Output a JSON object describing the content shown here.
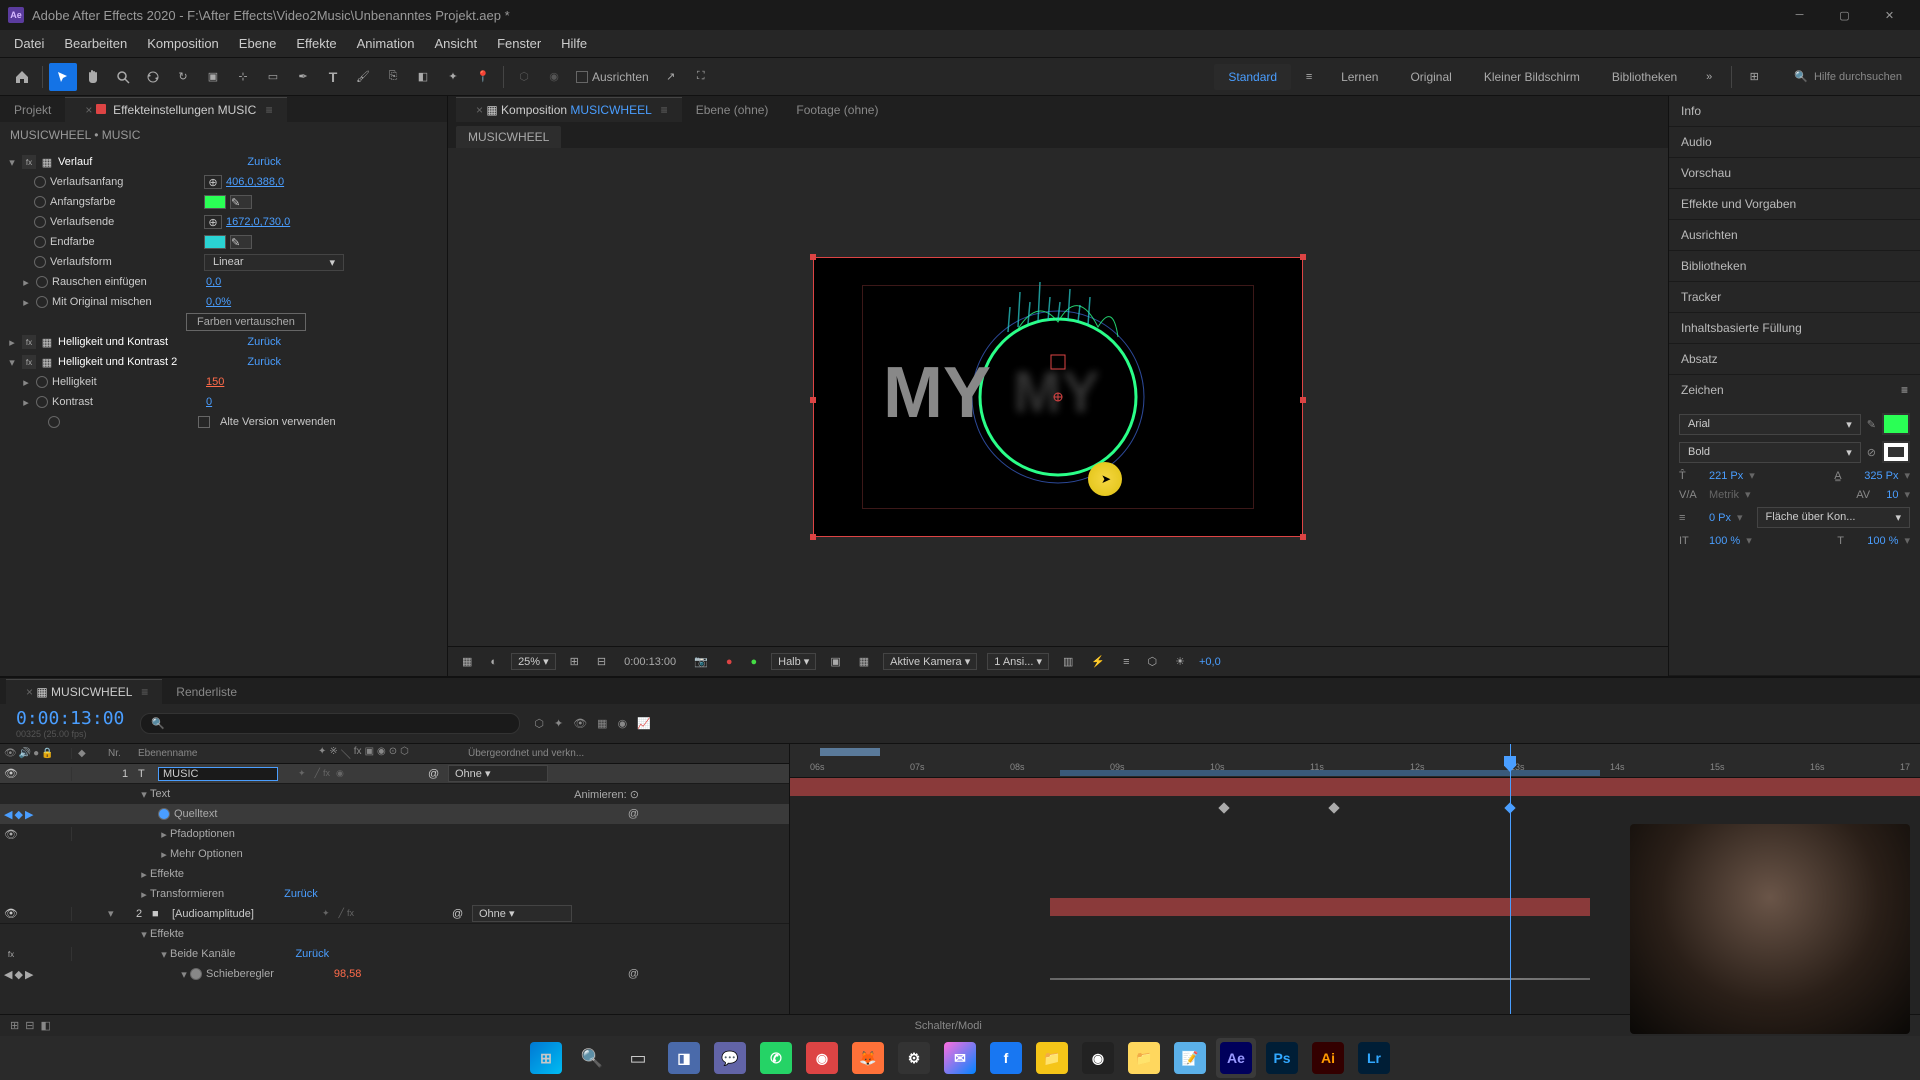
{
  "titlebar": {
    "app": "Ae",
    "title": "Adobe After Effects 2020 - F:\\After Effects\\Video2Music\\Unbenanntes Projekt.aep *"
  },
  "menu": [
    "Datei",
    "Bearbeiten",
    "Komposition",
    "Ebene",
    "Effekte",
    "Animation",
    "Ansicht",
    "Fenster",
    "Hilfe"
  ],
  "toolbar": {
    "align_label": "Ausrichten",
    "workspaces": [
      "Standard",
      "Lernen",
      "Original",
      "Kleiner Bildschirm",
      "Bibliotheken"
    ],
    "active_workspace": 0,
    "search_placeholder": "Hilfe durchsuchen"
  },
  "left": {
    "tabs": [
      "Projekt",
      "Effekteinstellungen MUSIC"
    ],
    "active_tab": 1,
    "breadcrumb": "MUSICWHEEL • MUSIC",
    "effects": {
      "verlauf": {
        "name": "Verlauf",
        "reset": "Zurück",
        "anfang": {
          "label": "Verlaufsanfang",
          "value": "406,0,388,0"
        },
        "anfangsfarbe": {
          "label": "Anfangsfarbe",
          "color": "#2aff55"
        },
        "ende": {
          "label": "Verlaufsende",
          "value": "1672,0,730,0"
        },
        "endfarbe": {
          "label": "Endfarbe",
          "color": "#2ad4d4"
        },
        "form": {
          "label": "Verlaufsform",
          "value": "Linear"
        },
        "rauschen": {
          "label": "Rauschen einfügen",
          "value": "0,0"
        },
        "mischen": {
          "label": "Mit Original mischen",
          "value": "0,0%"
        },
        "swap": "Farben vertauschen"
      },
      "hk1": {
        "name": "Helligkeit und Kontrast",
        "reset": "Zurück"
      },
      "hk2": {
        "name": "Helligkeit und Kontrast 2",
        "reset": "Zurück",
        "helligkeit": {
          "label": "Helligkeit",
          "value": "150"
        },
        "kontrast": {
          "label": "Kontrast",
          "value": "0"
        },
        "alte": "Alte Version verwenden"
      }
    }
  },
  "center": {
    "tabs": {
      "comp_prefix": "Komposition",
      "comp_name": "MUSICWHEEL",
      "ebene": "Ebene (ohne)",
      "footage": "Footage (ohne)"
    },
    "crumb": "MUSICWHEEL",
    "preview_text": "MY",
    "viewer": {
      "zoom": "25%",
      "timecode": "0:00:13:00",
      "res": "Halb",
      "camera": "Aktive Kamera",
      "views": "1 Ansi...",
      "exposure": "+0,0"
    }
  },
  "right": {
    "sections": [
      "Info",
      "Audio",
      "Vorschau",
      "Effekte und Vorgaben",
      "Ausrichten",
      "Bibliotheken",
      "Tracker",
      "Inhaltsbasierte Füllung",
      "Absatz"
    ],
    "zeichen": {
      "title": "Zeichen",
      "font": "Arial",
      "weight": "Bold",
      "fill": "#2aff55",
      "size": "221 Px",
      "leading": "325 Px",
      "kerning": "Metrik",
      "tracking": "10",
      "stroke_w": "0 Px",
      "stroke_mode": "Fläche über Kon...",
      "vscale": "100 %",
      "hscale": "100 %"
    }
  },
  "timeline": {
    "tabs": [
      "MUSICWHEEL",
      "Renderliste"
    ],
    "timecode": "0:00:13:00",
    "fps_label": "00325 (25.00 fps)",
    "cols": {
      "nr": "Nr.",
      "name": "Ebenenname",
      "parent": "Übergeordnet und verkn..."
    },
    "layers": {
      "l1": {
        "num": "1",
        "name": "MUSIC",
        "color": "#d44",
        "parent": "Ohne",
        "props": {
          "text": "Text",
          "animieren": "Animieren:",
          "quelltext": "Quelltext",
          "pfad": "Pfadoptionen",
          "mehr": "Mehr Optionen",
          "effekte": "Effekte",
          "transform": "Transformieren",
          "transform_reset": "Zurück"
        }
      },
      "l2": {
        "num": "2",
        "name": "[Audioamplitude]",
        "color": "#eee",
        "parent": "Ohne",
        "props": {
          "effekte": "Effekte",
          "beide": "Beide Kanäle",
          "beide_reset": "Zurück",
          "schieberegler": "Schieberegler",
          "schieberegler_val": "98,58"
        }
      }
    },
    "ruler_ticks": [
      "06s",
      "07s",
      "08s",
      "09s",
      "10s",
      "11s",
      "12s",
      "13s",
      "14s",
      "15s",
      "16s",
      "17"
    ],
    "footer": "Schalter/Modi"
  },
  "taskbar": {
    "apps": [
      "win",
      "search",
      "tasks",
      "widgets",
      "chat",
      "whatsapp",
      "brave",
      "firefox",
      "discord",
      "messenger",
      "facebook",
      "files",
      "obs",
      "explorer",
      "notepad",
      "ae",
      "ps",
      "ai",
      "lr"
    ]
  }
}
